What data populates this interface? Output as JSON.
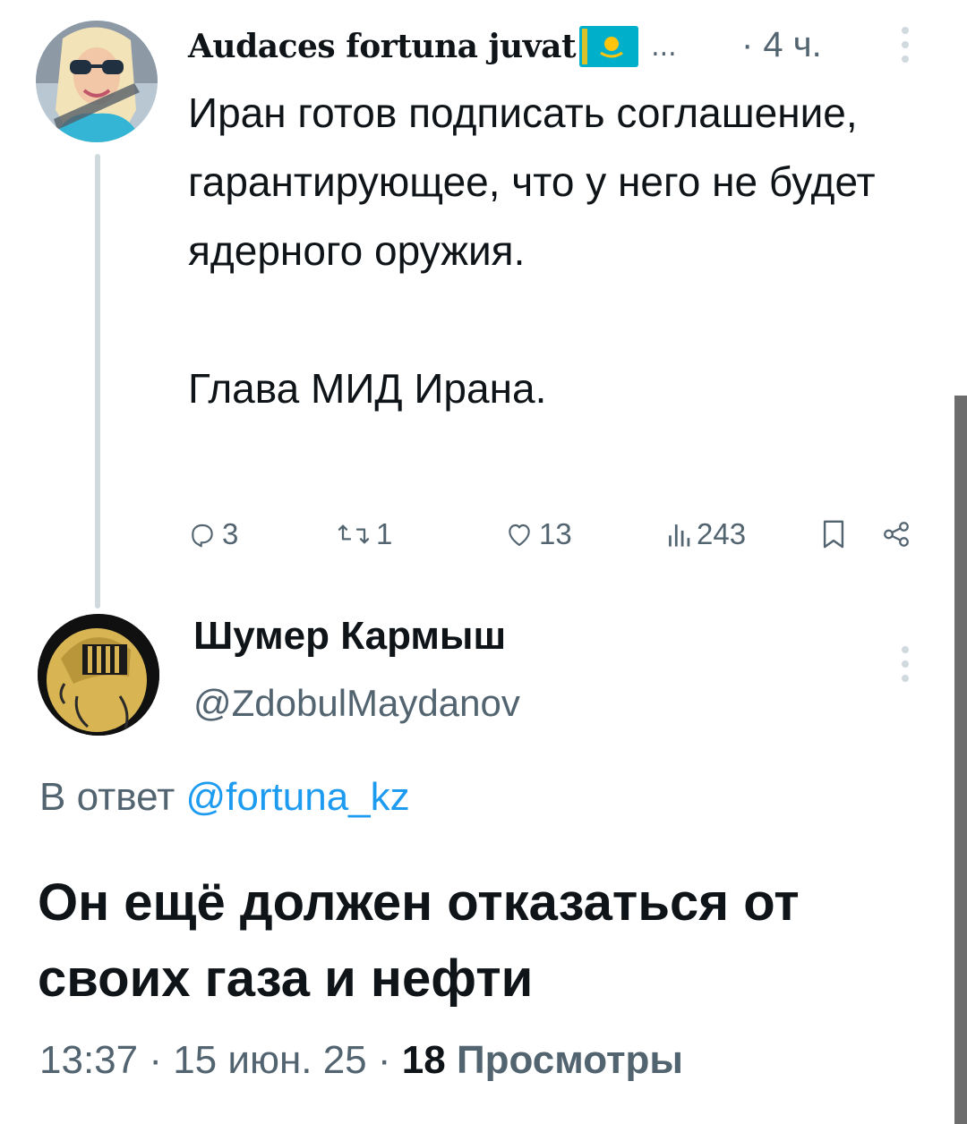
{
  "parent_tweet": {
    "author_name": "Audaces fortuna juvat",
    "ellipsis": "...",
    "time": "· 4 ч.",
    "text": "Иран готов подписать соглашение, гарантирующее, что у него не будет ядерного оружия.\n\nГлава МИД Ирана.",
    "actions": {
      "replies": "3",
      "retweets": "1",
      "likes": "13",
      "views": "243"
    },
    "flag_colors": {
      "field": "#00afca",
      "sun": "#fec50c"
    }
  },
  "reply_tweet": {
    "author_name": "Шумер Кармыш",
    "handle": "@ZdobulMaydanov",
    "reply_to_prefix": "В ответ",
    "reply_to_mention": "@fortuna_kz",
    "text": "Он ещё должен отказаться от своих газа и нефти",
    "timestamp": "13:37 · 15 июн. 25 ·",
    "views_count": "18",
    "views_label": "Просмотры"
  },
  "colors": {
    "text_primary": "#0f1419",
    "text_secondary": "#536471",
    "link": "#1d9bf0",
    "thread_line": "#cfd9de"
  }
}
